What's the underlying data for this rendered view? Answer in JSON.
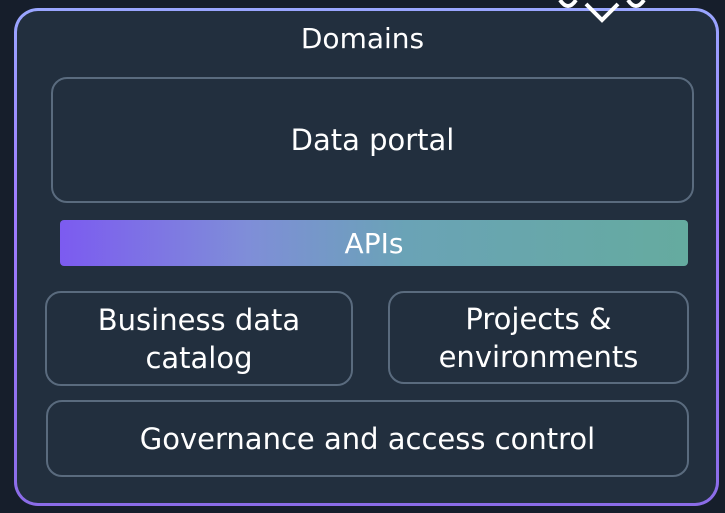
{
  "diagram": {
    "title": "Domains",
    "data_portal": "Data portal",
    "apis": "APIs",
    "business_catalog": "Business data catalog",
    "projects_environments": "Projects & environments",
    "governance": "Governance and access control"
  },
  "colors": {
    "background": "#161e2b",
    "panel": "#222f3e",
    "box_border": "#5a6b7e",
    "apis_gradient_start": "#7c5bf0",
    "apis_gradient_end": "#65ab9f",
    "outer_border": "#a07cff",
    "text": "#ffffff"
  },
  "icons": {
    "top_decoration": "network-nodes-icon"
  }
}
